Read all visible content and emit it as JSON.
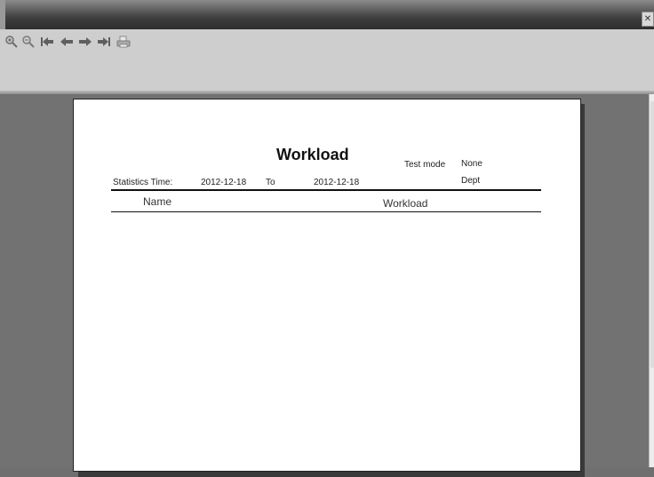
{
  "window": {
    "close_glyph": "✕"
  },
  "toolbar": {
    "buttons": [
      {
        "name": "zoom-in-icon"
      },
      {
        "name": "zoom-out-icon"
      },
      {
        "name": "first-page-icon"
      },
      {
        "name": "previous-page-icon"
      },
      {
        "name": "next-page-icon"
      },
      {
        "name": "last-page-icon"
      },
      {
        "name": "print-icon"
      }
    ]
  },
  "report": {
    "title": "Workload",
    "test_mode_label": "Test mode",
    "test_mode_value": "None",
    "statistics_time_label": "Statistics Time:",
    "date_from": "2012-12-18",
    "to_label": "To",
    "date_to": "2012-12-18",
    "dept_label": "Dept",
    "columns": [
      "Name",
      "Workload"
    ]
  },
  "colors": {
    "workspace": "#727272",
    "toolbar": "#cecece",
    "page": "#ffffff"
  }
}
